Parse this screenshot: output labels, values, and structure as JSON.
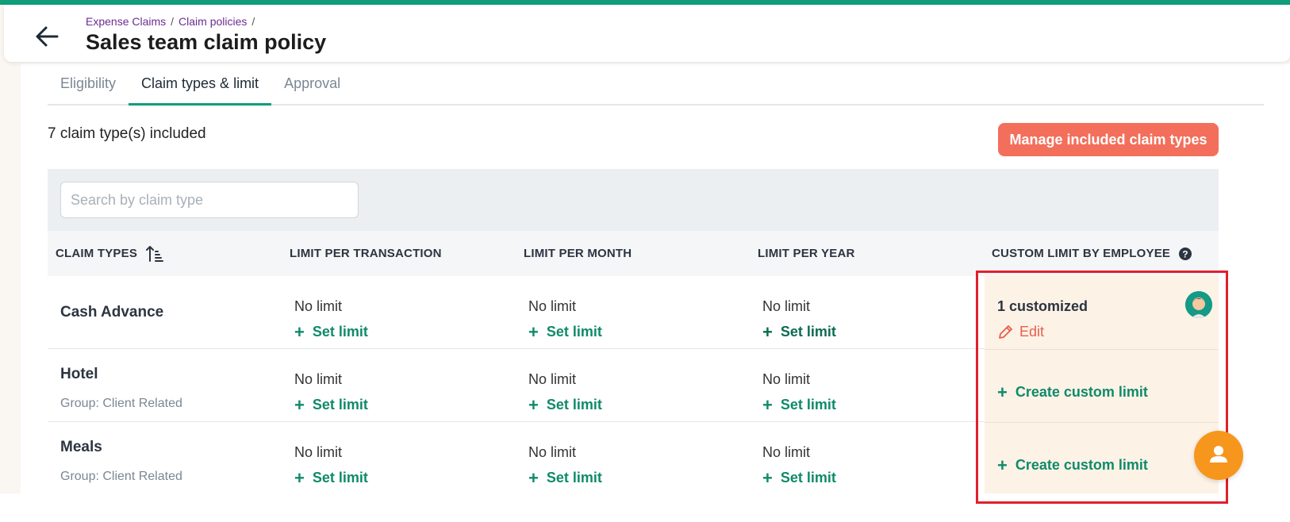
{
  "breadcrumb": {
    "items": [
      "Expense Claims",
      "Claim policies"
    ],
    "separator": "/"
  },
  "page_title": "Sales team claim policy",
  "tabs": [
    {
      "label": "Eligibility",
      "active": false
    },
    {
      "label": "Claim types & limit",
      "active": true
    },
    {
      "label": "Approval",
      "active": false
    }
  ],
  "summary": {
    "count_text": "7 claim type(s) included",
    "manage_button": "Manage included claim types"
  },
  "search": {
    "placeholder": "Search by claim type",
    "value": ""
  },
  "table": {
    "headers": {
      "claim_types": "CLAIM TYPES",
      "per_transaction": "LIMIT PER TRANSACTION",
      "per_month": "LIMIT PER MONTH",
      "per_year": "LIMIT PER YEAR",
      "custom": "CUSTOM LIMIT BY EMPLOYEE"
    },
    "no_limit": "No limit",
    "set_limit": "Set limit",
    "rows": [
      {
        "name": "Cash Advance",
        "group": "",
        "custom_status": "1 customized",
        "custom_action": "Edit"
      },
      {
        "name": "Hotel",
        "group": "Group: Client Related",
        "custom_action": "Create custom limit"
      },
      {
        "name": "Meals",
        "group": "Group: Client Related",
        "custom_action": "Create custom limit"
      }
    ]
  },
  "colors": {
    "accent": "#0f9d7a",
    "primary_button": "#f36f5b",
    "highlight_box": "#e0202b",
    "chat_button": "#f7961c"
  },
  "icons": [
    "back-arrow-icon",
    "sort-ascending-icon",
    "help-icon",
    "plus-icon",
    "pencil-icon",
    "avatar",
    "chat-user-icon"
  ]
}
